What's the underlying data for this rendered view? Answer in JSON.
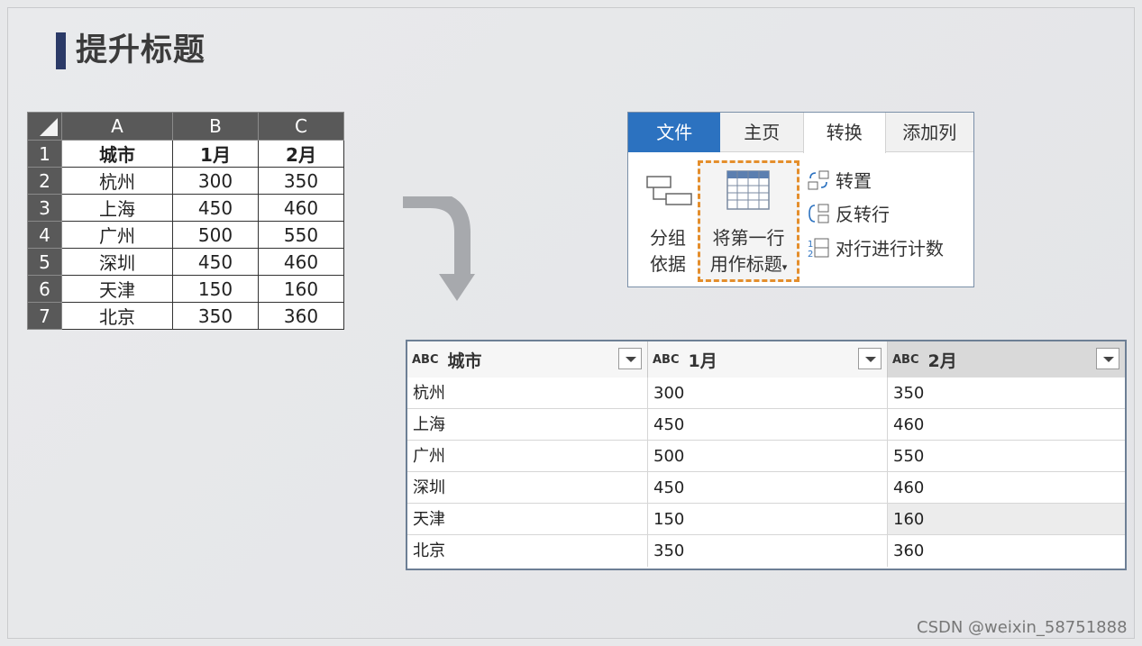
{
  "title": "提升标题",
  "excel": {
    "columns": [
      "A",
      "B",
      "C"
    ],
    "rows": [
      {
        "num": "1",
        "a": "城市",
        "b": "1月",
        "c": "2月"
      },
      {
        "num": "2",
        "a": "杭州",
        "b": "300",
        "c": "350"
      },
      {
        "num": "3",
        "a": "上海",
        "b": "450",
        "c": "460"
      },
      {
        "num": "4",
        "a": "广州",
        "b": "500",
        "c": "550"
      },
      {
        "num": "5",
        "a": "深圳",
        "b": "450",
        "c": "460"
      },
      {
        "num": "6",
        "a": "天津",
        "b": "150",
        "c": "160"
      },
      {
        "num": "7",
        "a": "北京",
        "b": "350",
        "c": "360"
      }
    ]
  },
  "ribbon": {
    "tabs": [
      "文件",
      "主页",
      "转换",
      "添加列"
    ],
    "group_by": [
      "分组",
      "依据"
    ],
    "promote": [
      "将第一行",
      "用作标题"
    ],
    "transpose": "转置",
    "reverse_rows": "反转行",
    "count_rows": "对行进行计数"
  },
  "query": {
    "type_icon": "ABC",
    "headers": [
      "城市",
      "1月",
      "2月"
    ],
    "rows": [
      [
        "杭州",
        "300",
        "350"
      ],
      [
        "上海",
        "450",
        "460"
      ],
      [
        "广州",
        "500",
        "550"
      ],
      [
        "深圳",
        "450",
        "460"
      ],
      [
        "天津",
        "150",
        "160"
      ],
      [
        "北京",
        "350",
        "360"
      ]
    ]
  },
  "watermark": "CSDN @weixin_58751888",
  "colors": {
    "accent_teal": "#1ea58f",
    "file_tab": "#2c72c0",
    "highlight": "#e48e2c",
    "title_bar": "#2b3a67"
  }
}
